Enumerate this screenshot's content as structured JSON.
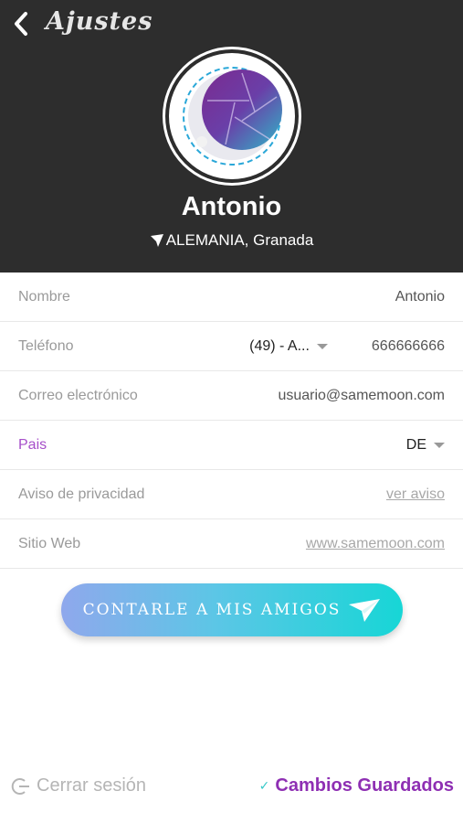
{
  "header": {
    "title": "Ajustes",
    "back_icon": "chevron-left-icon"
  },
  "profile": {
    "name": "Antonio",
    "location_icon": "location-arrow-icon",
    "location": "ALEMANIA, Granada",
    "avatar": "moon-shutter-logo"
  },
  "settings": {
    "name_label": "Nombre",
    "name_value": "Antonio",
    "phone_label": "Teléfono",
    "phone_code": "(49) - A...",
    "phone_value": "666666666",
    "email_label": "Correo electrónico",
    "email_value": "usuario@samemoon.com",
    "country_label": "Pais",
    "country_value": "DE",
    "privacy_label": "Aviso de privacidad",
    "privacy_link": "ver aviso",
    "website_label": "Sitio Web",
    "website_link": "www.samemoon.com"
  },
  "share": {
    "label": "CONTARLE A MIS AMIGOS",
    "icon": "send-icon"
  },
  "footer": {
    "logout_label": "Cerrar sesión",
    "saved_label": "Cambios Guardados"
  },
  "colors": {
    "header_bg": "#2d2d2d",
    "accent_purple": "#a64fc9",
    "saved_purple": "#8e2fb3",
    "button_gradient_start": "#8fa8ec",
    "button_gradient_end": "#17d6d6"
  }
}
